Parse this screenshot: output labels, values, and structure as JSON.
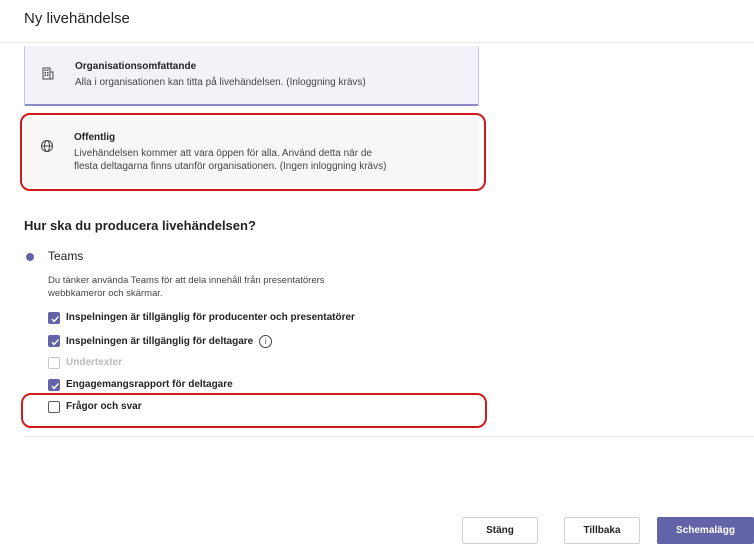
{
  "dialog": {
    "title": "Ny livehändelse"
  },
  "access_options": [
    {
      "icon": "building-icon",
      "title": "Organisationsomfattande",
      "description": "Alla i organisationen kan titta på livehändelsen. (Inloggning krävs)",
      "selected": true
    },
    {
      "icon": "globe-icon",
      "title": "Offentlig",
      "description_line1": "Livehändelsen kommer att vara öppen för alla. Använd detta när de",
      "description_line2": "flesta deltagarna finns utanför organisationen. (Ingen inloggning krävs)",
      "selected": false
    }
  ],
  "production": {
    "heading": "Hur ska du producera livehändelsen?",
    "method": {
      "label": "Teams",
      "selected": true,
      "description_line1": "Du tänker använda Teams för att dela innehåll från presentatörers",
      "description_line2": "webbkameror och skärmar."
    },
    "options": [
      {
        "label": "Inspelningen är tillgänglig för producenter och presentatörer",
        "checked": true,
        "disabled": false
      },
      {
        "label": "Inspelningen är tillgänglig för deltagare",
        "checked": true,
        "disabled": false,
        "info": "i"
      },
      {
        "label": "Undertexter",
        "checked": false,
        "disabled": true
      },
      {
        "label": "Engagemangsrapport för deltagare",
        "checked": true,
        "disabled": false
      },
      {
        "label": "Frågor och svar",
        "checked": false,
        "disabled": false
      }
    ]
  },
  "footer": {
    "close_label": "Stäng",
    "back_label": "Tillbaka",
    "schedule_label": "Schemalägg"
  },
  "colors": {
    "accent": "#6264a7",
    "highlight": "#d31a1a"
  }
}
